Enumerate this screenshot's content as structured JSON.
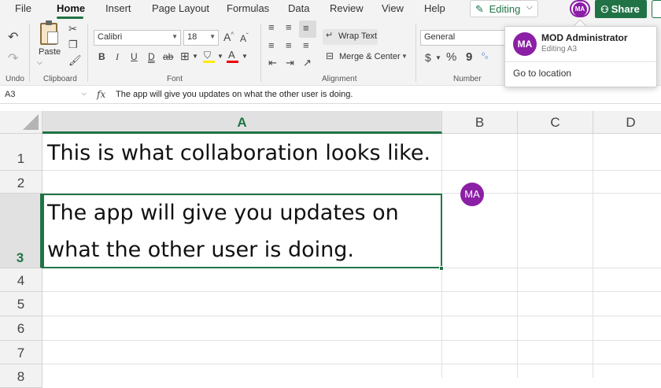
{
  "menu": {
    "tabs": [
      "File",
      "Home",
      "Insert",
      "Page Layout",
      "Formulas",
      "Data",
      "Review",
      "View",
      "Help"
    ],
    "active_tab": "Home",
    "editing_label": "Editing",
    "share_label": "Share",
    "user_initials": "MA"
  },
  "ribbon": {
    "groups": {
      "undo": "Undo",
      "clipboard": "Clipboard",
      "font": "Font",
      "alignment": "Alignment",
      "number": "Number"
    },
    "paste_label": "Paste",
    "font_name": "Calibri",
    "font_size": "18",
    "wrap_text_label": "Wrap Text",
    "merge_center_label": "Merge & Center",
    "number_format": "General",
    "bold": "B",
    "italic": "I",
    "underline": "U",
    "double_underline": "D",
    "strikethrough": "ab",
    "grow_font": "A",
    "shrink_font": "A",
    "currency": "$",
    "percent": "%",
    "comma": "9"
  },
  "formula_bar": {
    "name_box": "A3",
    "fx": "fx",
    "content": "The app will give you updates on what the other user is doing."
  },
  "sheet": {
    "columns": [
      "A",
      "B",
      "C",
      "D"
    ],
    "selected_column": "A",
    "rows": [
      "1",
      "2",
      "3",
      "4",
      "5",
      "6",
      "7",
      "8"
    ],
    "selected_row": "3",
    "cells": {
      "A1": "This is what collaboration looks like.",
      "A3_line1": "The app will give you updates on",
      "A3_line2": "what the other user is doing."
    },
    "presence_initials": "MA"
  },
  "popup": {
    "initials": "MA",
    "name": "MOD Administrator",
    "status": "Editing A3",
    "action": "Go to location"
  },
  "colors": {
    "accent": "#217346",
    "presence": "#8b1fa5"
  }
}
